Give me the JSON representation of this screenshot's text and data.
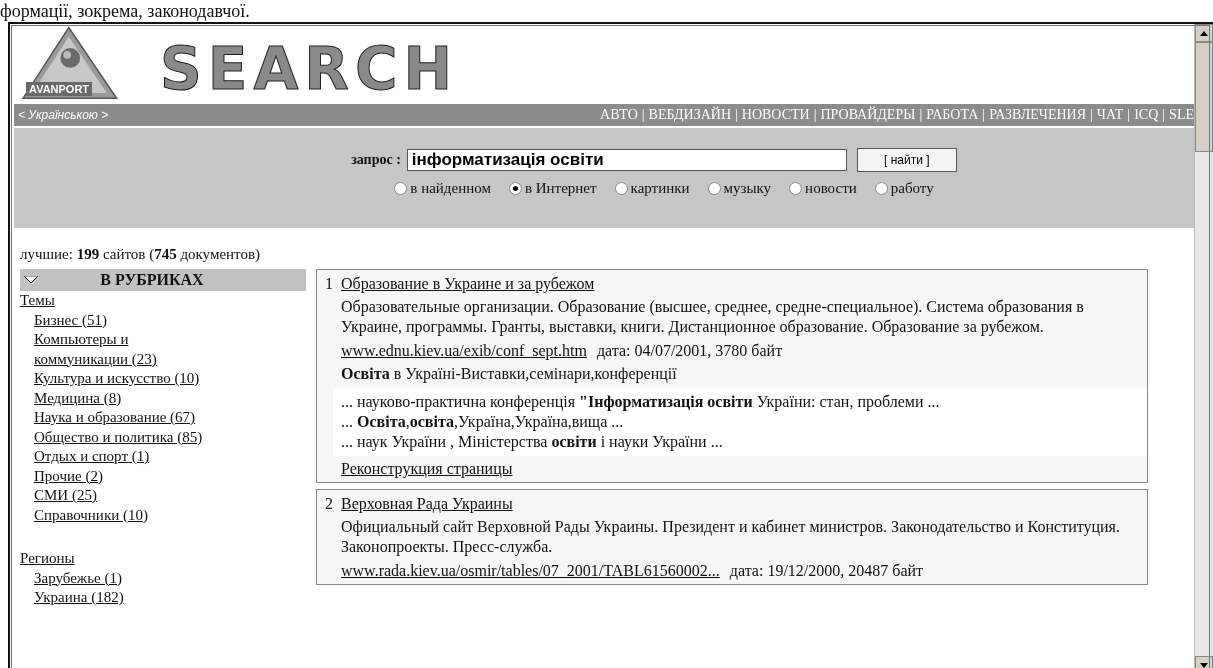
{
  "caption_above": "формації, зокрема, законодавчої.",
  "header": {
    "logo_text": "AVANPORT",
    "wordmark": "SEARCH",
    "language_link": "< Українською >",
    "nav_separator": "|",
    "nav": [
      "АВТО",
      "ВЕБДИЗАЙН",
      "НОВОСТИ",
      "ПРОВАЙДЕРЫ",
      "РАБОТА",
      "РАЗВЛЕЧЕНИЯ",
      "ЧАТ",
      "ICQ",
      "SLE"
    ]
  },
  "search": {
    "label": "запрос :",
    "value": "інформатизація освіти",
    "button": "[ найти ]",
    "scopes": [
      {
        "label": "в найденном",
        "selected": false
      },
      {
        "label": "в Интернет",
        "selected": true
      },
      {
        "label": "картинки",
        "selected": false
      },
      {
        "label": "музыку",
        "selected": false
      },
      {
        "label": "новости",
        "selected": false
      },
      {
        "label": "работу",
        "selected": false
      }
    ]
  },
  "summary": "лучшие: **199** сайтов (**745** документов)",
  "sidebar": {
    "title": "В РУБРИКАХ",
    "expanded": true,
    "groups": [
      {
        "label": "Темы",
        "children": [
          {
            "label": "Бизнес (51)"
          },
          {
            "label": "Компьютеры и коммуникации (23)"
          },
          {
            "label": "Культура и искусство (10)"
          },
          {
            "label": "Медицина (8)"
          },
          {
            "label": "Наука и образование (67)"
          },
          {
            "label": "Общество и политика (85)"
          },
          {
            "label": "Отдых и спорт (1)"
          },
          {
            "label": "Прочие (2)"
          },
          {
            "label": "СМИ (25)"
          },
          {
            "label": "Справочники (10)"
          }
        ]
      },
      {
        "label": "Регионы",
        "children": [
          {
            "label": "Зарубежье (1)"
          },
          {
            "label": "Украина (182)"
          }
        ]
      }
    ]
  },
  "results": [
    {
      "number": "1",
      "title": "Образование в Украине и за рубежом",
      "description": "Образовательные организации. Образование (высшее, среднее, средне-специальное). Система образования в Украине, программы. Гранты, выставки, книги. Дистанционное образование. Образование за рубежом.",
      "url": "www.ednu.kiev.ua/exib/conf_sept.htm",
      "meta": "дата: 04/07/2001, 3780 байт",
      "page_title": "**Освіта** в Україні-Виставки,семінари,конференції",
      "snippets": [
        "... науково-практична конференція **\"Інформатизація освіти** України: стан, проблеми ...",
        "... **Освіта**,**освіта**,Україна,Україна,вища ...",
        "... наук України , Міністерства **освіти** і науки України ..."
      ],
      "link": "Реконструкция страницы"
    },
    {
      "number": "2",
      "title": "Верховная Рада Украины",
      "description": "Официальный сайт Верховной Рады Украины. Президент и кабинет министров. Законодательство и Конституция. Законопроекты. Пресс-служба.",
      "url": "www.rada.kiev.ua/osmir/tables/07_2001/TABL61560002...",
      "meta": "дата: 19/12/2000, 20487 байт"
    }
  ]
}
